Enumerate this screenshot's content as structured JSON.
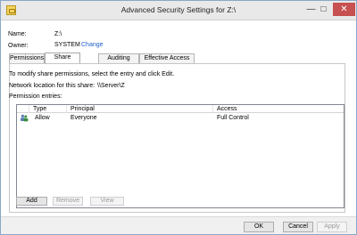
{
  "window": {
    "title": "Advanced Security Settings for Z:\\",
    "minimize_glyph": "—",
    "maximize_glyph": "□",
    "close_glyph": "✕"
  },
  "object": {
    "name_label": "Name:",
    "name_value": "Z:\\",
    "owner_label": "Owner:",
    "owner_value": "SYSTEM",
    "change_link": "Change"
  },
  "tabs": [
    {
      "label": "Permissions",
      "active": false
    },
    {
      "label": "Share",
      "active": true
    },
    {
      "label": "Auditing",
      "active": false
    },
    {
      "label": "Effective Access",
      "active": false
    }
  ],
  "share": {
    "description": "To modify share permissions, select the entry and click Edit.",
    "network_location_label": "Network location for this share:",
    "network_location_value": "\\\\Server\\Z",
    "entries_label": "Permission entries:"
  },
  "table": {
    "columns": [
      "Type",
      "Principal",
      "Access"
    ],
    "rows": [
      {
        "icon": "users-icon",
        "type": "Allow",
        "principal": "Everyone",
        "access": "Full Control"
      }
    ]
  },
  "buttons": {
    "add": "Add",
    "remove": "Remove",
    "view": "View",
    "ok": "OK",
    "cancel": "Cancel",
    "apply": "Apply"
  },
  "colors": {
    "link": "#1c5ec6",
    "close_button": "#c75050",
    "window_border": "#8aa7c8"
  }
}
